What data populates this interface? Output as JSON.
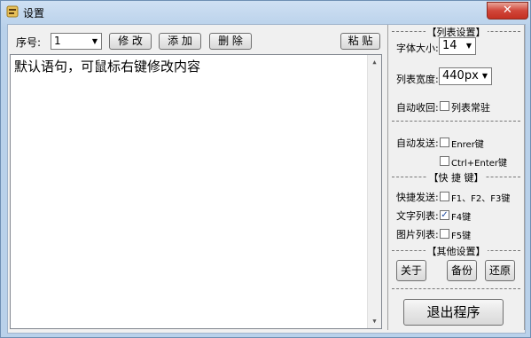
{
  "window": {
    "title": "设置",
    "close_label": "✕"
  },
  "toolbar": {
    "index_label": "序号:",
    "index_value": "1",
    "edit_label": "修 改",
    "add_label": "添 加",
    "delete_label": "删 除",
    "paste_label": "粘 贴"
  },
  "editor": {
    "content": "默认语句，可鼠标右键修改内容"
  },
  "list_settings": {
    "header": "【列表设置】",
    "font_size_label": "字体大小:",
    "font_size_value": "14",
    "width_label": "列表宽度:",
    "width_value": "440px",
    "auto_collapse_label": "自动收回:",
    "always_show_label": "列表常驻",
    "always_show_checked": false
  },
  "auto_send": {
    "label": "自动发送:",
    "enter_label": "Enrer键",
    "enter_checked": false,
    "ctrl_enter_label": "Ctrl+Enter键",
    "ctrl_enter_checked": false
  },
  "shortcuts": {
    "header": "【快 捷 键】",
    "quick_send_label": "快捷发送:",
    "quick_send_keys": "F1、F2、F3键",
    "quick_send_checked": false,
    "text_list_label": "文字列表:",
    "text_list_key": "F4键",
    "text_list_checked": true,
    "image_list_label": "图片列表:",
    "image_list_key": "F5键",
    "image_list_checked": false
  },
  "other": {
    "header": "【其他设置】",
    "about_label": "关于",
    "backup_label": "备份",
    "restore_label": "还原"
  },
  "exit_label": "退出程序"
}
